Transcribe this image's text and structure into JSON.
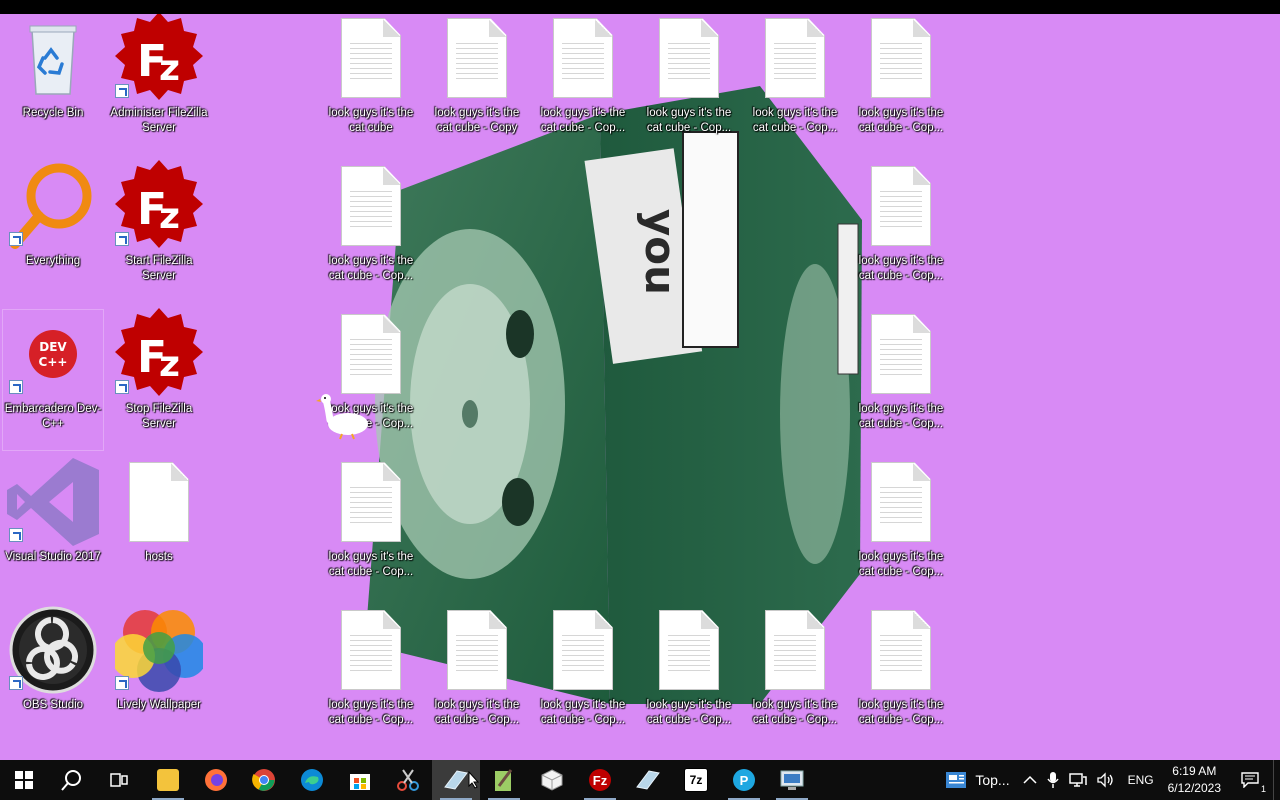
{
  "desktop": {
    "left_icons": [
      {
        "label": "Recycle Bin"
      },
      {
        "label": "Administer FileZilla Server"
      },
      {
        "label": "Everything"
      },
      {
        "label": "Start FileZilla Server"
      },
      {
        "label": "Embarcadero Dev-C++"
      },
      {
        "label": "Stop FileZilla Server"
      },
      {
        "label": "Visual Studio 2017"
      },
      {
        "label": "hosts"
      },
      {
        "label": "OBS Studio"
      },
      {
        "label": "Lively Wallpaper"
      }
    ],
    "files": [
      {
        "label": "look guys it's the cat cube"
      },
      {
        "label": "look guys it's the cat cube - Copy"
      },
      {
        "label": "look guys it's the cat cube - Cop..."
      },
      {
        "label": "look guys it's the cat cube - Cop..."
      },
      {
        "label": "look guys it's the cat cube - Cop..."
      },
      {
        "label": "look guys it's the cat cube - Cop..."
      },
      {
        "label": "look guys it's the cat cube - Cop..."
      },
      {
        "label": "look guys it's the cat cube - Cop..."
      },
      {
        "label": "look guys it's the cat cube - Cop..."
      },
      {
        "label": "look guys it's the cat cube - Cop..."
      },
      {
        "label": "look guys it's the cat cube - Cop..."
      },
      {
        "label": "look guys it's the cat cube - Cop..."
      },
      {
        "label": "look guys it's the cat cube - Cop..."
      },
      {
        "label": "look guys it's the cat cube - Cop..."
      },
      {
        "label": "look guys it's the cat cube - Cop..."
      },
      {
        "label": "look guys it's the cat cube - Cop..."
      },
      {
        "label": "look guys it's the cat cube - Cop..."
      },
      {
        "label": "look guys it's the cat cube - Cop..."
      }
    ],
    "wallpaper_text": "you",
    "background_color": "#d88af5"
  },
  "taskbar": {
    "apps": [
      {
        "name": "start-icon"
      },
      {
        "name": "search-icon"
      },
      {
        "name": "task-view-icon"
      },
      {
        "name": "file-explorer-icon"
      },
      {
        "name": "firefox-icon"
      },
      {
        "name": "chrome-icon"
      },
      {
        "name": "edge-icon"
      },
      {
        "name": "store-icon"
      },
      {
        "name": "snipping-tool-icon"
      },
      {
        "name": "paint-icon"
      },
      {
        "name": "notepad-icon"
      },
      {
        "name": "cube-app-icon"
      },
      {
        "name": "filezilla-icon"
      },
      {
        "name": "eraser-icon"
      },
      {
        "name": "7zip-icon"
      },
      {
        "name": "p-app-icon"
      },
      {
        "name": "remote-desktop-icon"
      }
    ],
    "news_label": "Top...",
    "language": "ENG",
    "time": "6:19 AM",
    "date": "6/12/2023",
    "notification_count": "1"
  }
}
